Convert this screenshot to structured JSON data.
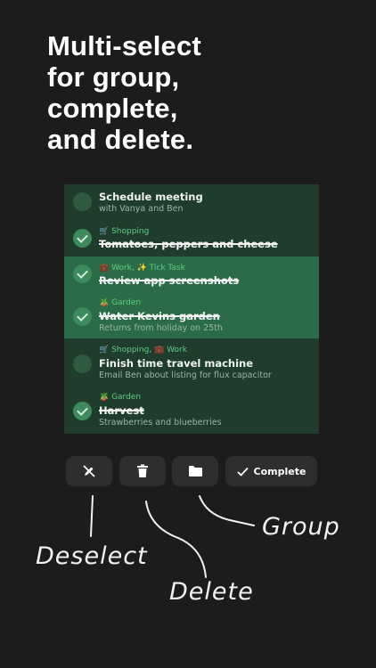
{
  "headline": [
    "Multi-select",
    "for group,",
    "complete,",
    "and delete."
  ],
  "tasks": [
    {
      "title": "Schedule meeting",
      "subtitle": "with Vanya and Ben",
      "tags": "",
      "done": false,
      "highlighted": false
    },
    {
      "title": "Tomatoes, peppers and cheese",
      "subtitle": "",
      "tags": "🛒 Shopping",
      "done": true,
      "highlighted": false
    },
    {
      "title": "Review app screenshots",
      "subtitle": "",
      "tags": "💼 Work, ✨ Tick Task",
      "done": true,
      "highlighted": true
    },
    {
      "title": "Water Kevins garden",
      "subtitle": "Returns from holiday on 25th",
      "tags": "🪴 Garden",
      "done": true,
      "highlighted": true
    },
    {
      "title": "Finish time travel machine",
      "subtitle": "Email Ben about listing for flux capacitor",
      "tags": "🛒 Shopping, 💼 Work",
      "done": false,
      "highlighted": false
    },
    {
      "title": "Harvest",
      "subtitle": "Strawberries and blueberries",
      "tags": "🪴 Garden",
      "done": true,
      "highlighted": false
    }
  ],
  "toolbar": {
    "complete_label": "Complete"
  },
  "annotations": {
    "deselect": "Deselect",
    "delete": "Delete",
    "group": "Group"
  },
  "icons": {
    "deselect": "pencil-slash-icon",
    "delete": "trash-icon",
    "group": "folder-icon",
    "complete": "checkmark-icon"
  },
  "colors": {
    "background": "#1c1c1c",
    "list_bg": "#1f3c2d",
    "highlight": "#2c6b47",
    "tag_green": "#5fcf84",
    "button_bg": "#2e2e2e"
  }
}
